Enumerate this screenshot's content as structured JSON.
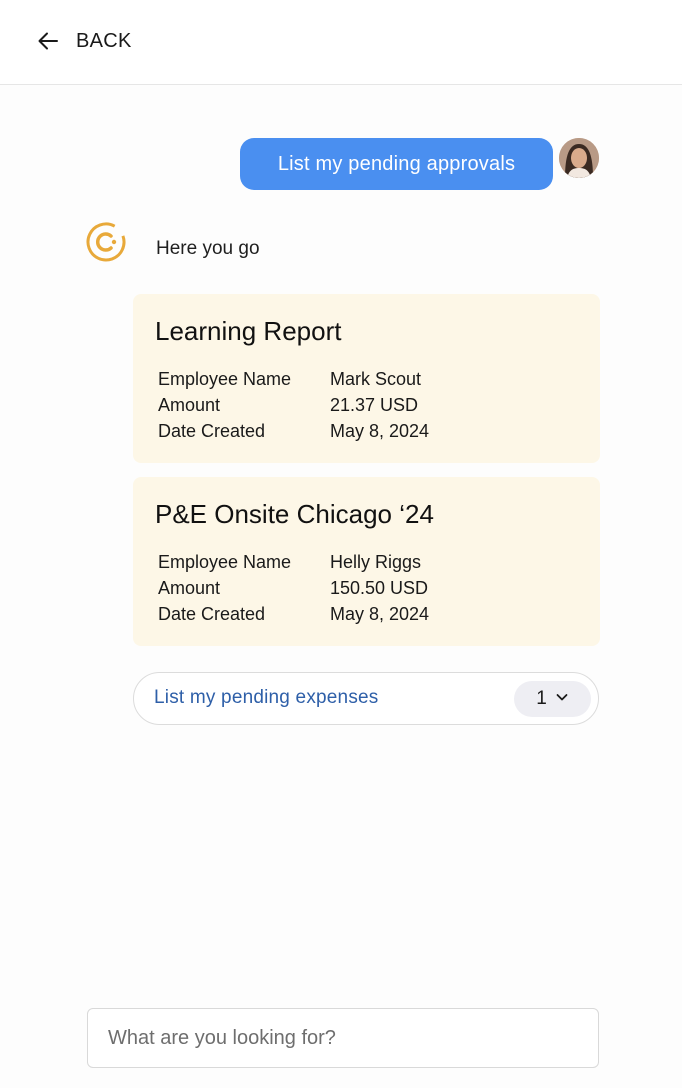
{
  "header": {
    "back_label": "BACK"
  },
  "chat": {
    "user_message": "List my pending approvals",
    "bot_reply": "Here you go"
  },
  "approvals": [
    {
      "title": "Learning Report",
      "rows": [
        {
          "label": "Employee Name",
          "value": "Mark Scout"
        },
        {
          "label": "Amount",
          "value": "21.37 USD"
        },
        {
          "label": "Date Created",
          "value": "May 8, 2024"
        }
      ]
    },
    {
      "title": "P&E Onsite Chicago ‘24",
      "rows": [
        {
          "label": "Employee Name",
          "value": "Helly Riggs"
        },
        {
          "label": "Amount",
          "value": "150.50 USD"
        },
        {
          "label": "Date Created",
          "value": "May 8, 2024"
        }
      ]
    }
  ],
  "suggestion": {
    "label": "List my pending expenses",
    "count": "1"
  },
  "search": {
    "placeholder": "What are you looking for?"
  },
  "colors": {
    "user_bubble": "#4a8ff0",
    "card_bg": "#fdf7e7",
    "brand_logo": "#e8a93a",
    "suggestion_text": "#2e5fa8"
  },
  "icons": {
    "back": "arrow-left-icon",
    "logo": "brand-logo-icon",
    "count_toggle": "chevron-down-icon"
  }
}
